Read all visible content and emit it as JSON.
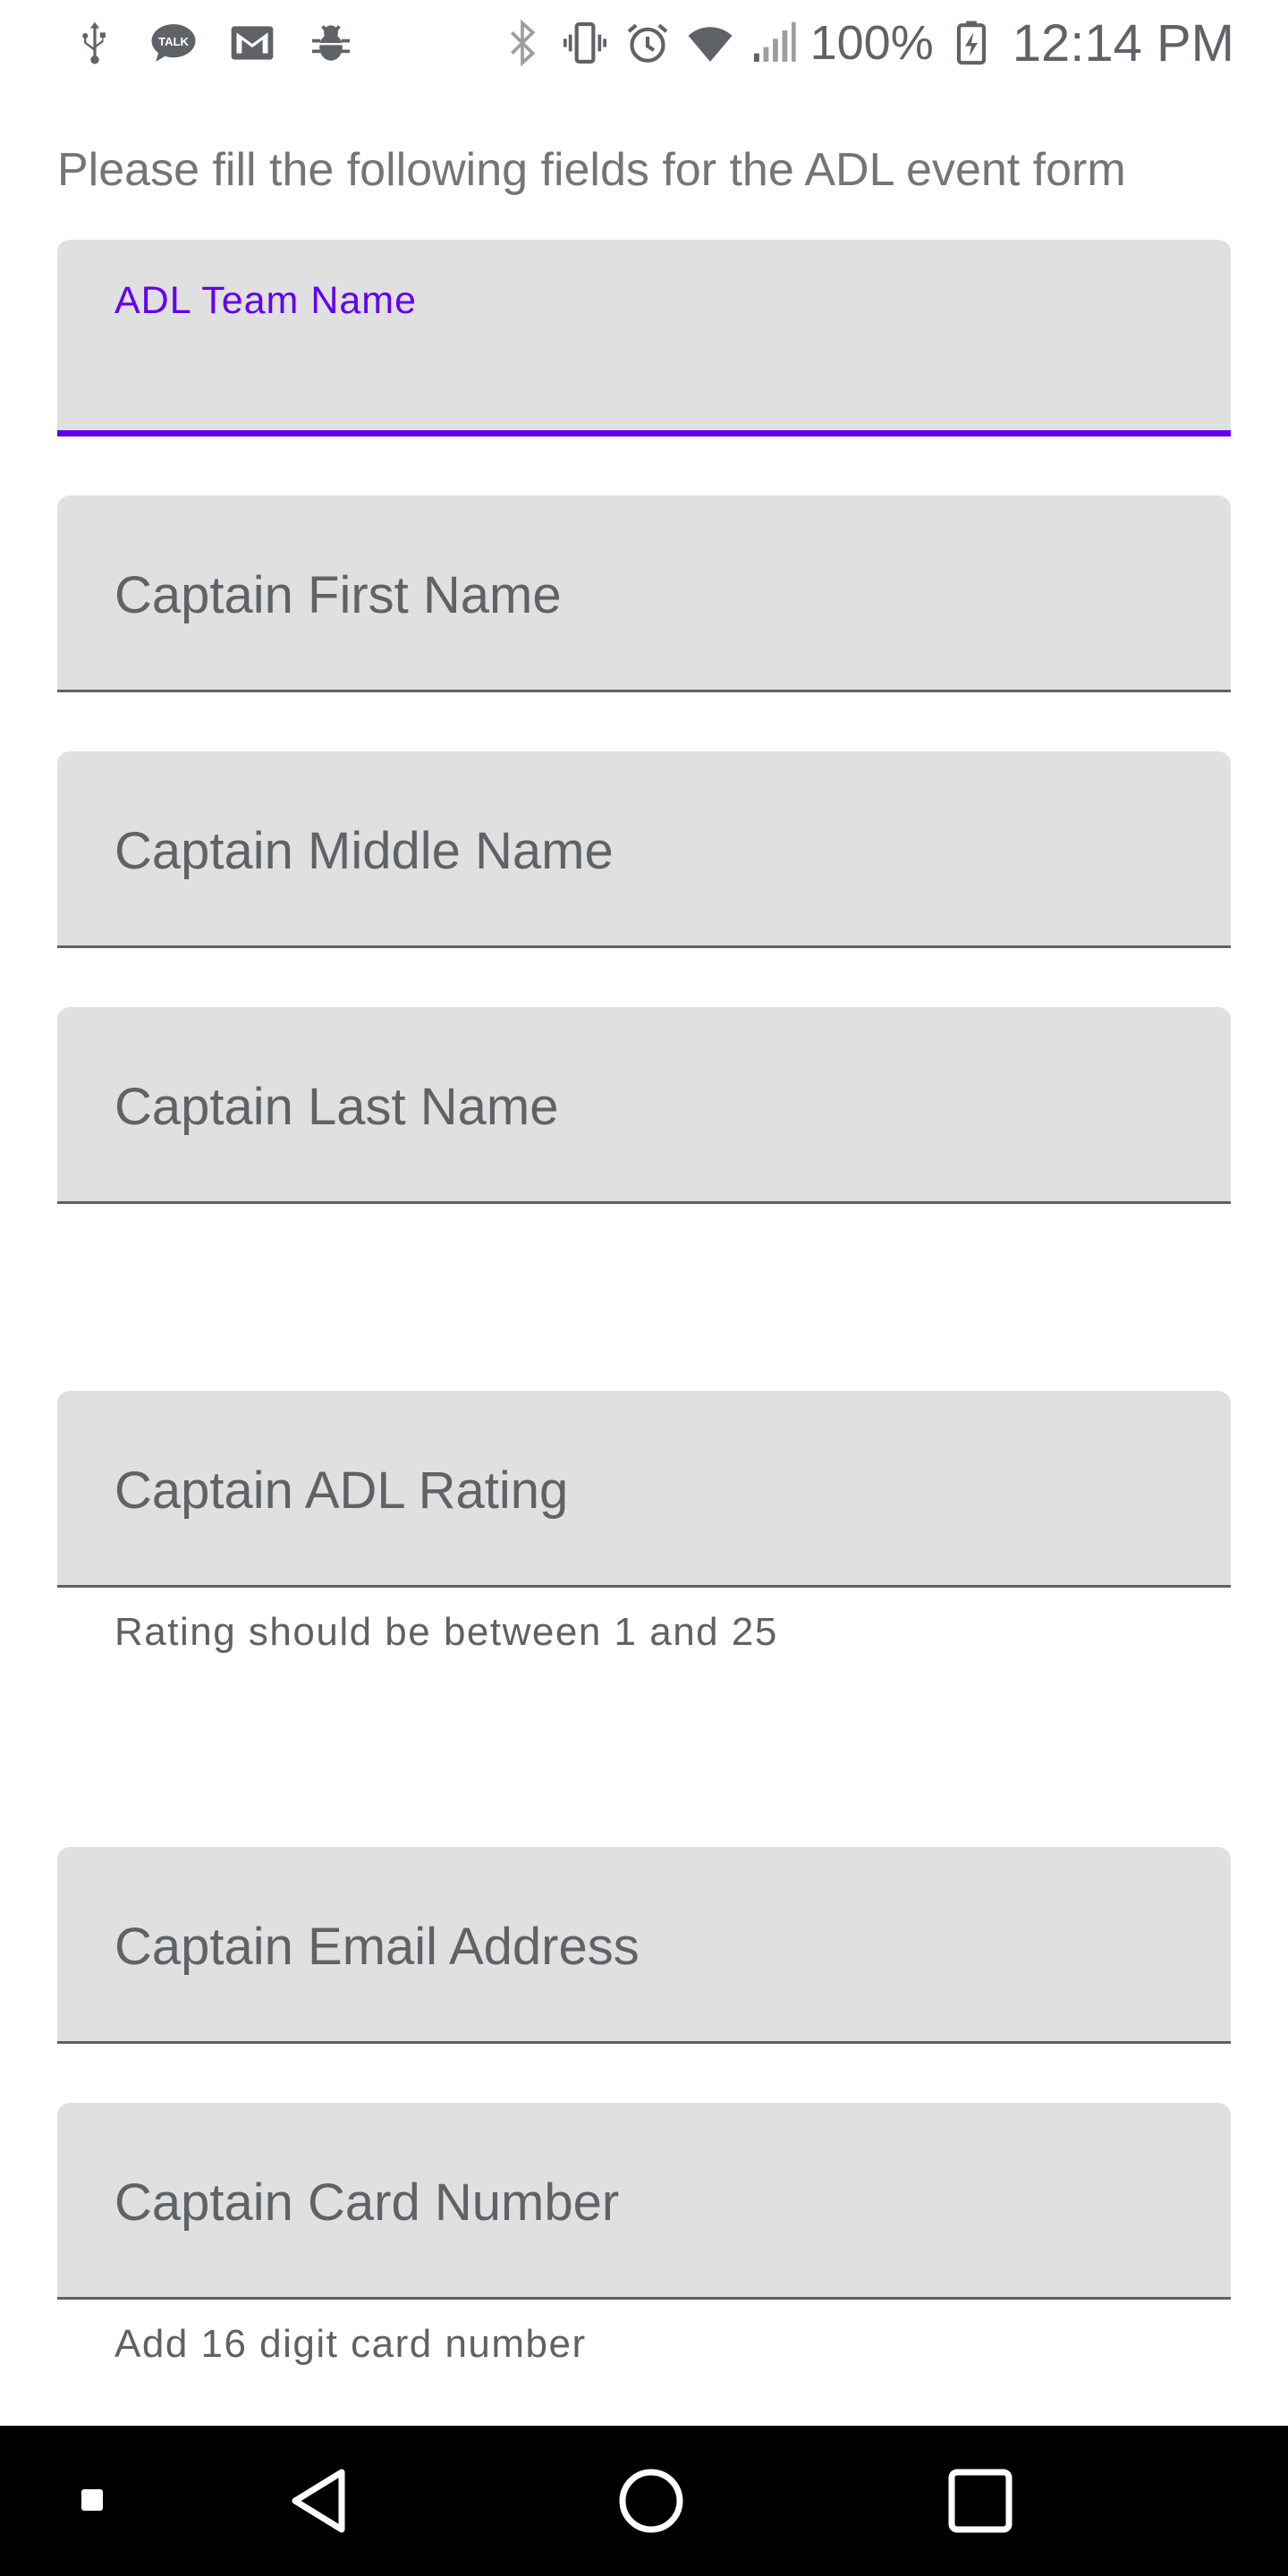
{
  "status_bar": {
    "left_icons": [
      "usb-icon",
      "talk-icon",
      "gmail-icon",
      "bug-icon"
    ],
    "right_icons": [
      "bluetooth-icon",
      "vibrate-icon",
      "alarm-icon",
      "wifi-icon",
      "signal-icon",
      "battery-charging-icon"
    ],
    "talk_badge": "TALK",
    "battery": "100%",
    "time": "12:14 PM"
  },
  "form": {
    "intro": "Please fill the following fields for the ADL event form",
    "fields": [
      {
        "label": "ADL Team Name",
        "value": "",
        "active": true,
        "helper": ""
      },
      {
        "label": "Captain First Name",
        "value": "",
        "active": false,
        "helper": ""
      },
      {
        "label": "Captain Middle Name",
        "value": "",
        "active": false,
        "helper": ""
      },
      {
        "label": "Captain Last Name",
        "value": "",
        "active": false,
        "helper": ""
      },
      {
        "label": "Captain ADL Rating",
        "value": "",
        "active": false,
        "helper": "Rating should be between 1 and 25"
      },
      {
        "label": "Captain Email Address",
        "value": "",
        "active": false,
        "helper": ""
      },
      {
        "label": "Captain Card Number",
        "value": "",
        "active": false,
        "helper": "Add 16 digit card number"
      }
    ]
  },
  "nav_bar": {
    "buttons": [
      "square-dot-icon",
      "back-icon",
      "home-icon",
      "recents-icon"
    ]
  },
  "colors": {
    "accent": "#6200ee",
    "field_fill": "#e0e0e0",
    "text_secondary": "#5f6368",
    "nav_background": "#000000"
  }
}
